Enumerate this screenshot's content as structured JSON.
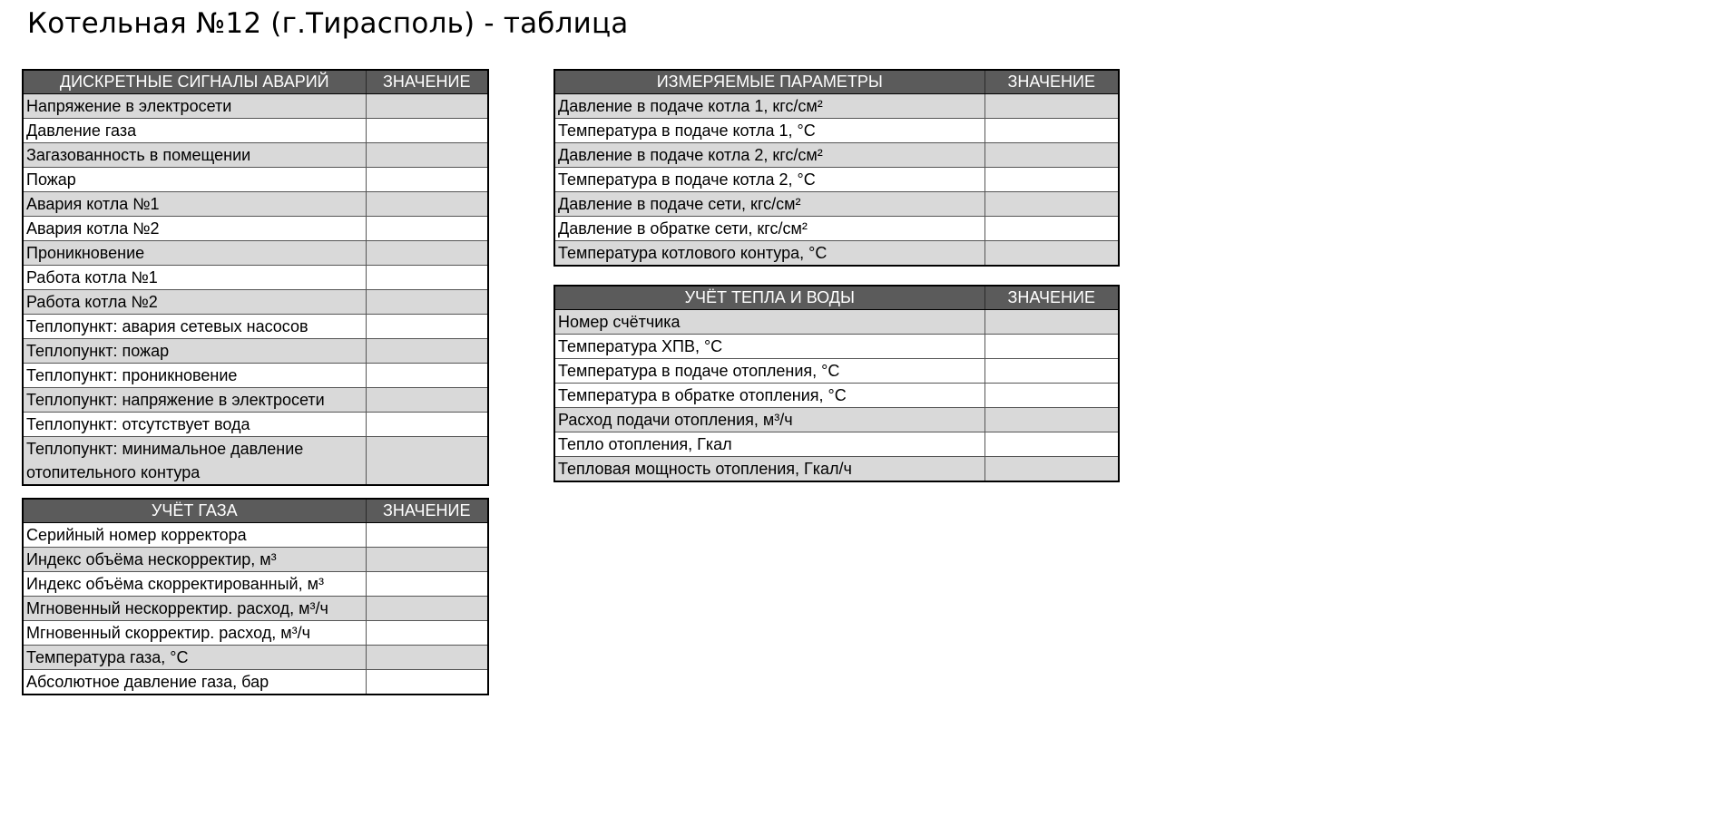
{
  "page": {
    "title": "Котельная №12 (г.Тирасполь) - таблица"
  },
  "alarms": {
    "header_name": "ДИСКРЕТНЫЕ СИГНАЛЫ АВАРИЙ",
    "header_value": "ЗНАЧЕНИЕ",
    "rows": [
      {
        "label": "Напряжение в электросети",
        "value": ""
      },
      {
        "label": "Давление газа",
        "value": ""
      },
      {
        "label": "Загазованность в помещении",
        "value": ""
      },
      {
        "label": "Пожар",
        "value": ""
      },
      {
        "label": "Авария котла №1",
        "value": ""
      },
      {
        "label": "Авария котла №2",
        "value": ""
      },
      {
        "label": "Проникновение",
        "value": ""
      },
      {
        "label": "Работа котла №1",
        "value": ""
      },
      {
        "label": "Работа котла №2",
        "value": ""
      },
      {
        "label": "Теплопункт: авария сетевых насосов",
        "value": ""
      },
      {
        "label": "Теплопункт: пожар",
        "value": ""
      },
      {
        "label": "Теплопункт: проникновение",
        "value": ""
      },
      {
        "label": "Теплопункт: напряжение в электросети",
        "value": ""
      },
      {
        "label": "Теплопункт: отсутствует вода",
        "value": ""
      },
      {
        "label": "Теплопункт: минимальное давление отопительного контура",
        "value": ""
      }
    ]
  },
  "gas": {
    "header_name": "УЧЁТ ГАЗА",
    "header_value": "ЗНАЧЕНИЕ",
    "rows": [
      {
        "label": "Серийный номер корректора",
        "value": ""
      },
      {
        "label": "Индекс объёма нескорректир, м³",
        "value": ""
      },
      {
        "label": "Индекс объёма скорректированный, м³",
        "value": ""
      },
      {
        "label": "Мгновенный нескорректир. расход, м³/ч",
        "value": ""
      },
      {
        "label": "Мгновенный скорректир. расход, м³/ч",
        "value": ""
      },
      {
        "label": "Температура газа, °С",
        "value": ""
      },
      {
        "label": "Абсолютное давление газа, бар",
        "value": ""
      }
    ]
  },
  "params": {
    "header_name": "ИЗМЕРЯЕМЫЕ ПАРАМЕТРЫ",
    "header_value": "ЗНАЧЕНИЕ",
    "rows": [
      {
        "label": "Давление в подаче котла 1, кгс/см²",
        "value": ""
      },
      {
        "label": "Температура в подаче котла 1, °С",
        "value": ""
      },
      {
        "label": "Давление в подаче котла 2, кгс/см²",
        "value": ""
      },
      {
        "label": "Температура в подаче котла 2, °С",
        "value": ""
      },
      {
        "label": "Давление в подаче сети, кгс/см²",
        "value": ""
      },
      {
        "label": "Давление в обратке сети, кгс/см²",
        "value": ""
      },
      {
        "label": "Температура котлового контура, °С",
        "value": ""
      }
    ]
  },
  "heat": {
    "header_name": "УЧЁТ ТЕПЛА И ВОДЫ",
    "header_value": "ЗНАЧЕНИЕ",
    "rows": [
      {
        "label": "Номер счётчика",
        "value": ""
      },
      {
        "label": "Температура ХПВ, °С",
        "value": ""
      },
      {
        "label": "Температура в подаче отопления, °С",
        "value": ""
      },
      {
        "label": "Температура в обратке отопления, °С",
        "value": ""
      },
      {
        "label": "Расход подачи отопления, м³/ч",
        "value": ""
      },
      {
        "label": "Тепло отопления, Гкал",
        "value": ""
      },
      {
        "label": "Тепловая мощность отопления, Гкал/ч",
        "value": ""
      }
    ]
  },
  "colors": {
    "header_bg": "#5b5b5b",
    "header_text": "#ffffff",
    "row_alt_bg": "#d9d9d9",
    "row_plain_bg": "#ffffff"
  }
}
